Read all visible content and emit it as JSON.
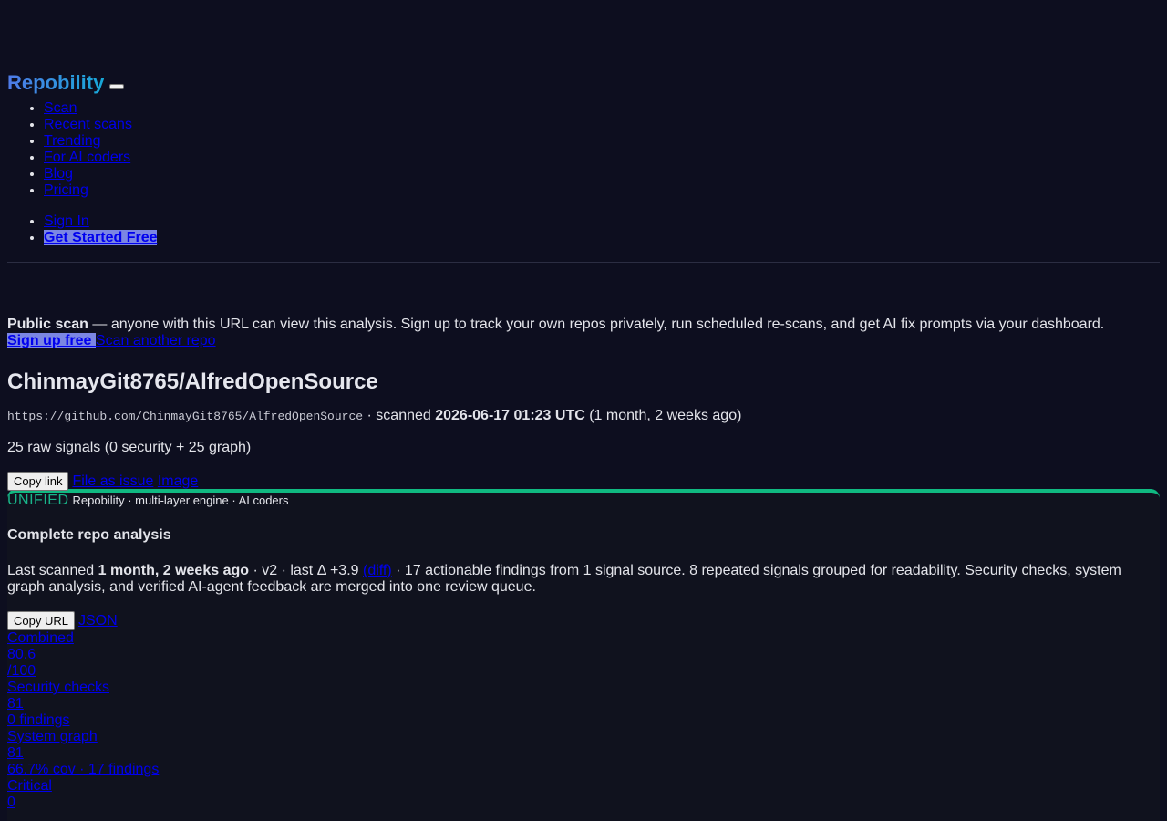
{
  "header": {
    "brand": "Repobility",
    "nav": [
      "Scan",
      "Recent scans",
      "Trending",
      "For AI coders",
      "Blog",
      "Pricing"
    ],
    "sign_in": "Sign In",
    "get_started": "Get Started Free"
  },
  "notice": {
    "bold": "Public scan",
    "text": " — anyone with this URL can view this analysis. Sign up to track your own repos privately, run scheduled re-scans, and get AI fix prompts via your dashboard.",
    "signup_label": "Sign up free ",
    "scan_another_label": "Scan another repo"
  },
  "repo": {
    "title": "ChinmayGit8765/AlfredOpenSource",
    "url": "https://github.com/ChinmayGit8765/AlfredOpenSource",
    "scanned_prefix": " · scanned ",
    "scanned_at": "2026-06-17 01:23 UTC",
    "scanned_ago": " (1 month, 2 weeks ago)",
    "signals": "25 raw signals (0 security + 25 graph)",
    "copy_link": "Copy link",
    "file_issue": "File as issue",
    "image_link": "Image"
  },
  "card": {
    "badge": "UNIFIED",
    "engine": "Repobility · multi-layer engine · AI coders",
    "heading": "Complete repo analysis",
    "last_scanned_prefix": "Last scanned ",
    "last_scanned_ago": "1 month, 2 weeks ago",
    "version_text": " · v2 · last Δ +3.9 ",
    "diff_link": "(diff)",
    "summary": " · 17 actionable findings from 1 signal source. 8 repeated signals grouped for readability. Security checks, system graph analysis, and verified AI-agent feedback are merged into one review queue.",
    "copy_url": "Copy URL",
    "json_link": "JSON",
    "stats": [
      {
        "label": "Combined",
        "value": "80.6",
        "sub": "/100"
      },
      {
        "label": "Security checks",
        "value": "81",
        "sub": "0 findings"
      },
      {
        "label": "System graph",
        "value": "81",
        "sub": "66.7% cov · 17 findings"
      },
      {
        "label": "Critical",
        "value": "0",
        "sub": ""
      }
    ]
  },
  "colors": {
    "background": "#0d0e1f",
    "accent_green": "#10b981",
    "cta_bg": "#7b86e3"
  }
}
